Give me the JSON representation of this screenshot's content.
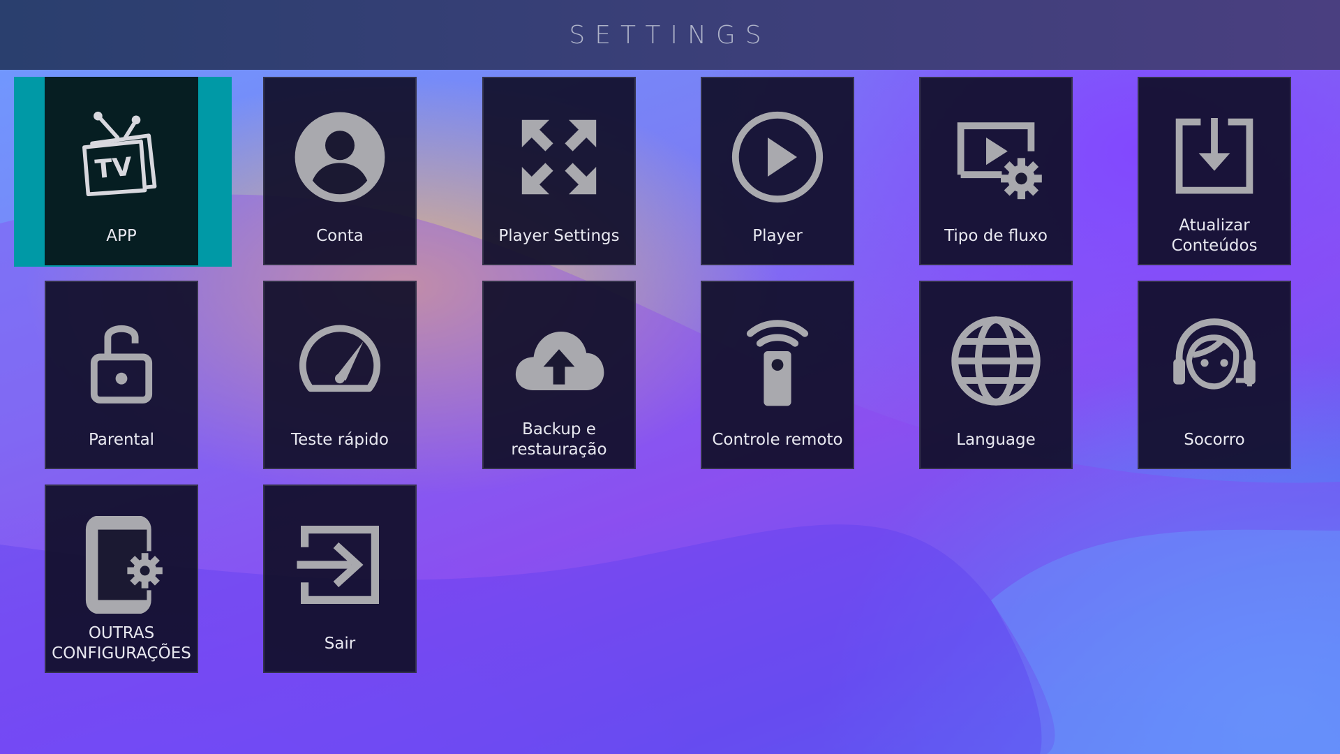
{
  "header": {
    "title": "SETTINGS"
  },
  "tiles": [
    {
      "label": "APP",
      "icon": "tv-icon"
    },
    {
      "label": "Conta",
      "icon": "account-icon"
    },
    {
      "label": "Player Settings",
      "icon": "fullscreen-icon"
    },
    {
      "label": "Player",
      "icon": "play-circle-icon"
    },
    {
      "label": "Tipo de fluxo",
      "icon": "video-settings-icon"
    },
    {
      "label": "Atualizar Conteúdos",
      "icon": "download-icon"
    },
    {
      "label": "Parental",
      "icon": "unlock-icon"
    },
    {
      "label": "Teste rápido",
      "icon": "speedometer-icon"
    },
    {
      "label": "Backup e restauração",
      "icon": "cloud-upload-icon"
    },
    {
      "label": "Controle remoto",
      "icon": "remote-control-icon"
    },
    {
      "label": "Language",
      "icon": "globe-icon"
    },
    {
      "label": "Socorro",
      "icon": "support-agent-icon"
    },
    {
      "label": "OUTRAS CONFIGURAÇÕES",
      "icon": "phone-settings-icon"
    },
    {
      "label": "Sair",
      "icon": "logout-icon"
    }
  ],
  "colors": {
    "focus_accent": "#0099a6",
    "tile_bg": "#110f2a",
    "icon": "#a9a9ae"
  }
}
